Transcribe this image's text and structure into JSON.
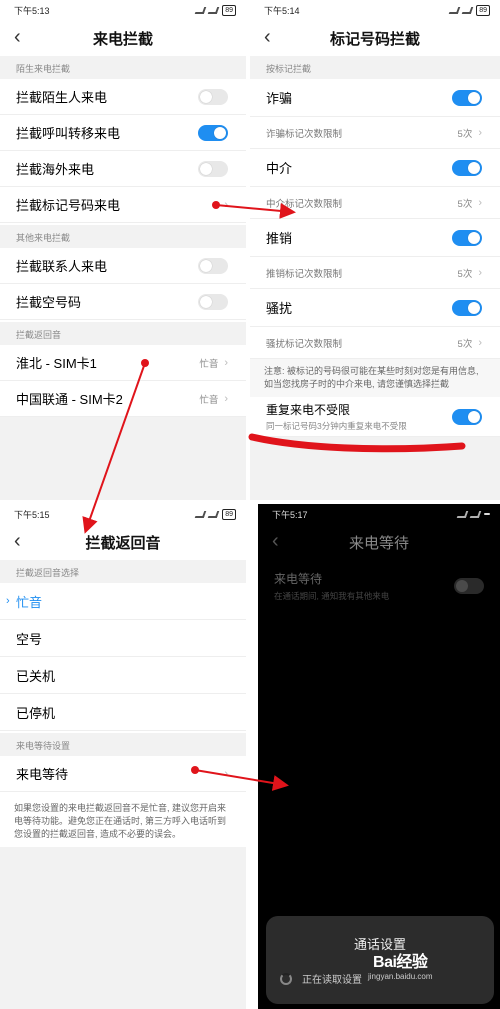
{
  "screen1": {
    "time": "下午5:13",
    "battery": "89",
    "title": "来电拦截",
    "section1": "陌生来电拦截",
    "row_stranger": "拦截陌生人来电",
    "row_forward": "拦截呼叫转移来电",
    "row_overseas": "拦截海外来电",
    "row_marked": "拦截标记号码来电",
    "section2": "其他来电拦截",
    "row_contacts": "拦截联系人来电",
    "row_empty": "拦截空号码",
    "section3": "拦截返回音",
    "sim1_label": "淮北 - SIM卡1",
    "sim1_value": "忙音",
    "sim2_label": "中国联通 - SIM卡2",
    "sim2_value": "忙音"
  },
  "screen2": {
    "time": "下午5:14",
    "battery": "89",
    "title": "标记号码拦截",
    "section": "按标记拦截",
    "items": [
      {
        "label": "诈骗",
        "limit_label": "诈骗标记次数限制",
        "limit": "5次"
      },
      {
        "label": "中介",
        "limit_label": "中介标记次数限制",
        "limit": "5次"
      },
      {
        "label": "推销",
        "limit_label": "推销标记次数限制",
        "limit": "5次"
      },
      {
        "label": "骚扰",
        "limit_label": "骚扰标记次数限制",
        "limit": "5次"
      }
    ],
    "note": "注意: 被标记的号码很可能在某些时刻对您是有用信息, 如当您找房子时的中介来电, 请您谨慎选择拦截",
    "repeat_title": "重复来电不受限",
    "repeat_sub": "同一标记号码3分钟内重复来电不受限"
  },
  "screen3": {
    "time": "下午5:15",
    "battery": "89",
    "title": "拦截返回音",
    "section1": "拦截返回音选择",
    "options": [
      "忙音",
      "空号",
      "已关机",
      "已停机"
    ],
    "section2": "来电等待设置",
    "wait_label": "来电等待",
    "note": "如果您设置的来电拦截返回音不是忙音, 建议您开启来电等待功能。避免您正在通话时, 第三方呼入电话听到您设置的拦截返回音, 造成不必要的误会。"
  },
  "screen4": {
    "time": "下午5:17",
    "title": "来电等待",
    "row_title": "来电等待",
    "row_sub": "在通话期间, 通知我有其他来电",
    "dialog_title": "通话设置",
    "dialog_body": "正在读取设置",
    "watermark": "Bai经验",
    "watermark_url": "jingyan.baidu.com"
  },
  "colors": {
    "accent": "#1f8ef1",
    "annotation": "#e0141b"
  }
}
